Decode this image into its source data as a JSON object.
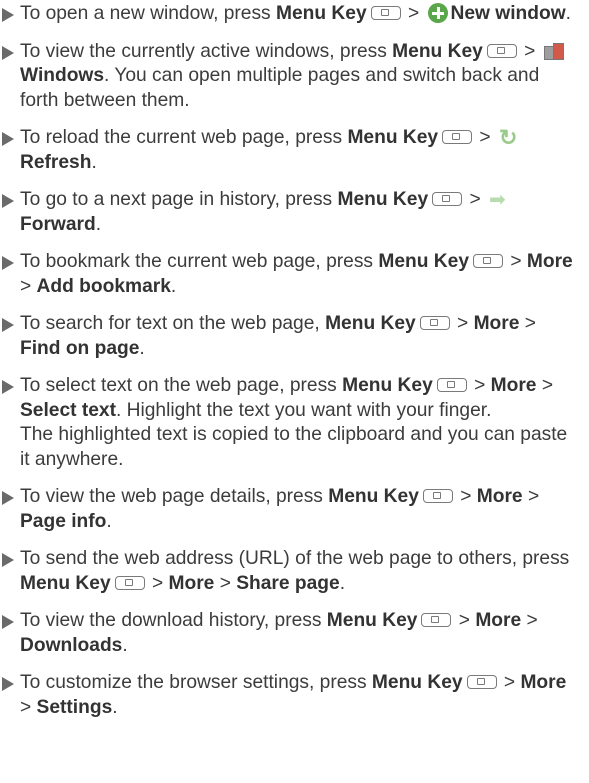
{
  "items": [
    {
      "p1": "To open a new window, press ",
      "menu": "Menu Key",
      "p2": " > ",
      "label": "New window",
      "p3": "."
    },
    {
      "p1": "To view the currently active windows, press ",
      "menu": "Menu Key",
      "p2": " > ",
      "label": "Windows",
      "p3": ". You can open multiple pages and switch back and forth between them."
    },
    {
      "p1": "To reload the current web page, press ",
      "menu": "Menu Key",
      "p2": " > ",
      "label": "Refresh",
      "p3": "."
    },
    {
      "p1": "To go to a next page in history, press ",
      "menu": "Menu Key",
      "p2": " > ",
      "label": "Forward",
      "p3": "."
    },
    {
      "p1": "To bookmark the current web page, press ",
      "menu": "Menu Key",
      "p2": " > ",
      "b1": "More",
      "p3": " > ",
      "b2": "Add bookmark",
      "p4": "."
    },
    {
      "p1": "To search for text on the web page, ",
      "menu": "Menu Key",
      "p2": " > ",
      "b1": "More",
      "p3": " > ",
      "b2": "Find on page",
      "p4": "."
    },
    {
      "p1": "To select text on the web page, press ",
      "menu": "Menu Key",
      "p2": " > ",
      "b1": "More",
      "p3": " > ",
      "b2": "Select text",
      "p4": ". Highlight the text you want with your finger.",
      "p5": "The highlighted text is copied to the clipboard and you can paste it anywhere."
    },
    {
      "p1": "To view the web page details, press ",
      "menu": "Menu Key",
      "p2": " > ",
      "b1": "More",
      "p3": " > ",
      "b2": "Page info",
      "p4": "."
    },
    {
      "p1": "To send the web address (URL) of the web page to others, press ",
      "menu": "Menu Key",
      "p2": " > ",
      "b1": "More",
      "p3": " > ",
      "b2": "Share page",
      "p4": "."
    },
    {
      "p1": "To view the download history, press ",
      "menu": "Menu Key",
      "p2": " > ",
      "b1": "More",
      "p3": " > ",
      "b2": "Downloads",
      "p4": "."
    },
    {
      "p1": "To customize the browser settings, press ",
      "menu": "Menu Key",
      "p2": " > ",
      "b1": "More",
      "p3": " > ",
      "b2": "Settings",
      "p4": "."
    }
  ],
  "icons": {
    "menu_key": "menu-key-icon",
    "new_window": "plus-circle-icon",
    "windows": "windows-icon",
    "refresh": "refresh-icon",
    "forward": "forward-arrow-icon"
  }
}
